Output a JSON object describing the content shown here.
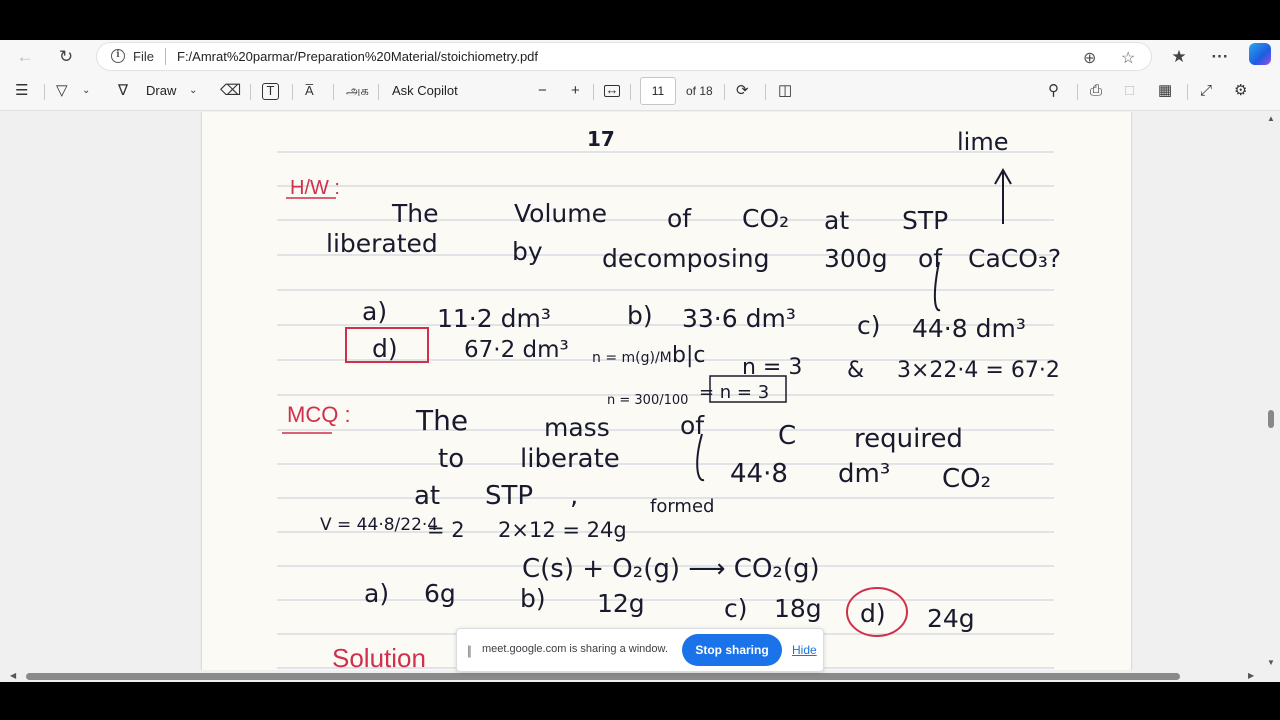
{
  "browser": {
    "url_scheme_label": "File",
    "url": "F:/Amrat%20parmar/Preparation%20Material/stoichiometry.pdf",
    "icons": [
      "back-icon",
      "refresh-icon",
      "info-icon",
      "zoom-icon",
      "favorite-icon",
      "favorites-icon",
      "more-icon",
      "copilot-icon"
    ]
  },
  "pdf_toolbar": {
    "draw_label": "Draw",
    "read_aloud_label": "A̅",
    "translate_glyph": "அக",
    "copilot_label": "Ask Copilot",
    "zoom_out": "−",
    "zoom_in": "+",
    "current_page": "11",
    "page_total": "of 18",
    "icons": [
      "contents-icon",
      "highlight-icon",
      "draw-icon",
      "erase-icon",
      "text-icon",
      "read-aloud-icon",
      "translate-icon",
      "fit-page-icon",
      "rotate-icon",
      "page-view-icon",
      "search-icon",
      "print-icon",
      "save-icon",
      "save-as-icon",
      "fullscreen-icon",
      "settings-icon"
    ]
  },
  "document": {
    "page_number": "17",
    "corner_note": "lime",
    "q1_tag": "H/W :",
    "q1_line1_words": [
      "The",
      "Volume",
      "of",
      "CO₂",
      "at",
      "STP"
    ],
    "q1_line2_words": [
      "liberated",
      "by",
      "decomposing",
      "300g",
      "of",
      "CaCO₃?"
    ],
    "q1_options": [
      "a)",
      "11·2 dm³",
      "b)",
      "33·6 dm³",
      "c)",
      "44·8 dm³",
      "d)",
      "67·2 dm³"
    ],
    "q1_work": [
      "n = m(g)/M",
      "b|c",
      "n = 3",
      "&",
      "3×22·4 = 67·2",
      "n = 300/100",
      "= n = 3"
    ],
    "q2_tag": "MCQ :",
    "q2_line1_words": [
      "The",
      "mass",
      "of",
      "C",
      "required"
    ],
    "q2_line2_words": [
      "to",
      "liberate",
      "44·8",
      "dm³",
      "CO₂"
    ],
    "q2_line3_words": [
      "at",
      "STP",
      ",",
      "formed"
    ],
    "q2_work": [
      "V = 44·8/22·4",
      "= 2",
      "2×12 = 24g"
    ],
    "equation": "C(s) + O₂(g) ⟶ CO₂(g)",
    "q2_options": [
      "a)",
      "6g",
      "b)",
      "12g",
      "c)",
      "18g",
      "d)",
      "24g"
    ],
    "solution_label": "Solution"
  },
  "sharing_banner": {
    "message": "meet.google.com is sharing a window.",
    "stop_label": "Stop sharing",
    "hide_label": "Hide"
  },
  "colors": {
    "accent": "#1a73e8",
    "ink": "#1a1a2e",
    "red_ink": "#d0304c",
    "paper": "#fbfaf5"
  }
}
